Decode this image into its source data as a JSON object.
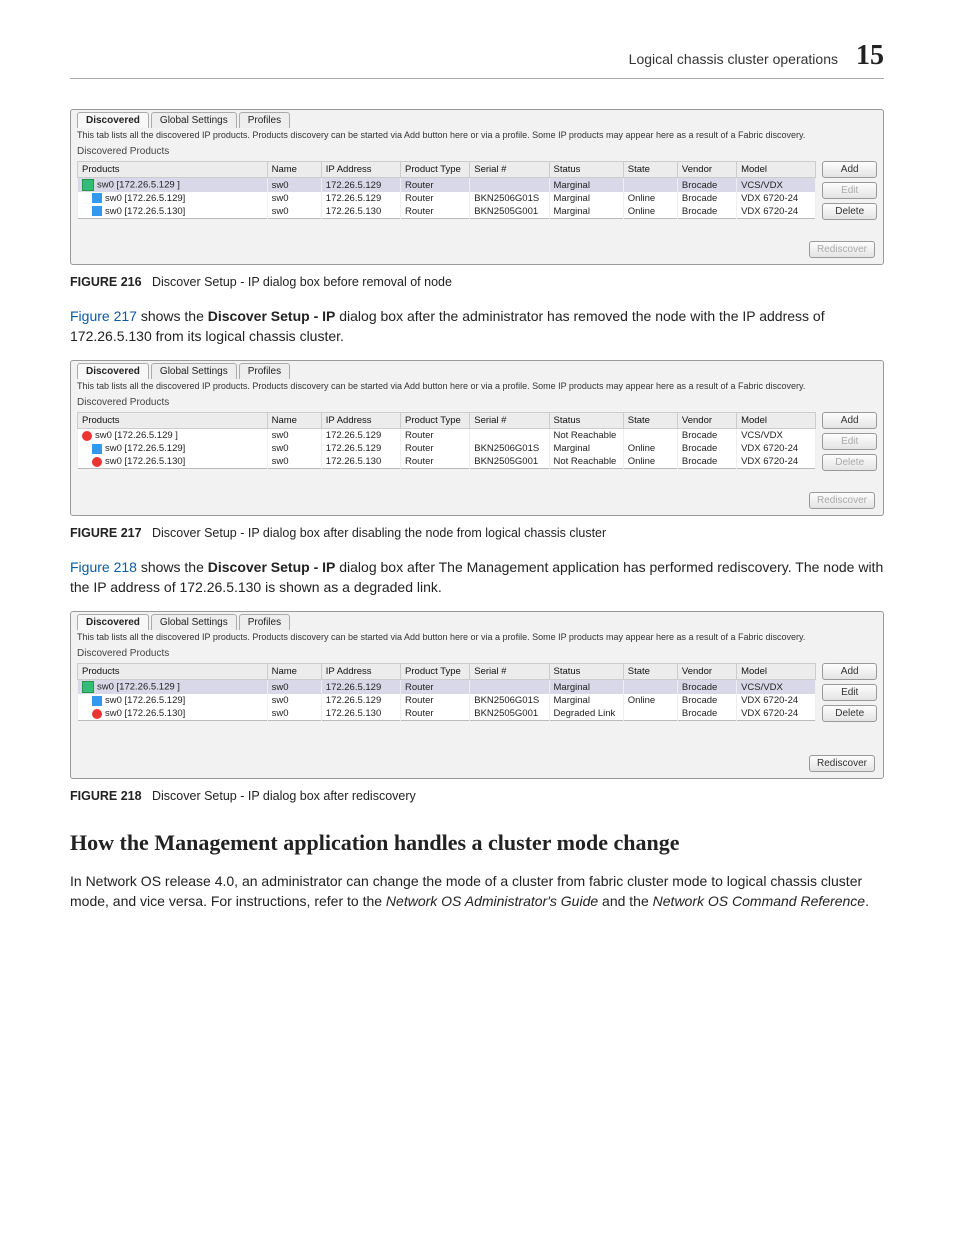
{
  "header": {
    "section": "Logical chassis cluster operations",
    "chapter": "15"
  },
  "tabs": {
    "t1": "Discovered",
    "t2": "Global Settings",
    "t3": "Profiles"
  },
  "hint": "This tab lists all the discovered IP products. Products discovery can be started via Add button here or via a profile. Some IP products may appear here as a result of a Fabric discovery.",
  "group": "Discovered Products",
  "columns": {
    "prod": "Products",
    "name": "Name",
    "ip": "IP Address",
    "ptype": "Product Type",
    "ser": "Serial #",
    "stat": "Status",
    "state": "State",
    "vend": "Vendor",
    "model": "Model"
  },
  "buttons": {
    "add": "Add",
    "edit": "Edit",
    "del": "Delete",
    "redisc": "Rediscover"
  },
  "fig216": {
    "caption_label": "FIGURE 216",
    "caption_text": "Discover Setup - IP dialog box before removal of node",
    "rows": [
      {
        "indent": 0,
        "iconkind": "tree",
        "prod": "sw0 [172.26.5.129 ]",
        "name": "sw0",
        "ip": "172.26.5.129",
        "ptype": "Router",
        "ser": "",
        "stat": "Marginal",
        "state": "",
        "vend": "Brocade",
        "model": "VCS/VDX",
        "sel": true
      },
      {
        "indent": 1,
        "iconkind": "node",
        "prod": "sw0 [172.26.5.129]",
        "name": "sw0",
        "ip": "172.26.5.129",
        "ptype": "Router",
        "ser": "BKN2506G01S",
        "stat": "Marginal",
        "state": "Online",
        "vend": "Brocade",
        "model": "VDX 6720-24"
      },
      {
        "indent": 1,
        "iconkind": "node",
        "prod": "sw0 [172.26.5.130]",
        "name": "sw0",
        "ip": "172.26.5.130",
        "ptype": "Router",
        "ser": "BKN2505G001",
        "stat": "Marginal",
        "state": "Online",
        "vend": "Brocade",
        "model": "VDX 6720-24"
      }
    ]
  },
  "para1": {
    "link": "Figure 217",
    "before": " shows the ",
    "bold": "Discover Setup - IP",
    "after": " dialog box after the administrator has removed the node with the IP address of 172.26.5.130 from its logical chassis cluster."
  },
  "fig217": {
    "caption_label": "FIGURE 217",
    "caption_text": "Discover Setup - IP dialog box after disabling the node from logical chassis cluster",
    "rows": [
      {
        "indent": 0,
        "iconkind": "sw",
        "prod": "sw0 [172.26.5.129 ]",
        "name": "sw0",
        "ip": "172.26.5.129",
        "ptype": "Router",
        "ser": "",
        "stat": "Not Reachable",
        "state": "",
        "vend": "Brocade",
        "model": "VCS/VDX"
      },
      {
        "indent": 1,
        "iconkind": "node",
        "prod": "sw0 [172.26.5.129]",
        "name": "sw0",
        "ip": "172.26.5.129",
        "ptype": "Router",
        "ser": "BKN2506G01S",
        "stat": "Marginal",
        "state": "Online",
        "vend": "Brocade",
        "model": "VDX 6720-24"
      },
      {
        "indent": 1,
        "iconkind": "sw",
        "prod": "sw0 [172.26.5.130]",
        "name": "sw0",
        "ip": "172.26.5.130",
        "ptype": "Router",
        "ser": "BKN2505G001",
        "stat": "Not Reachable",
        "state": "Online",
        "vend": "Brocade",
        "model": "VDX 6720-24"
      }
    ]
  },
  "para2": {
    "link": "Figure 218",
    "before": " shows the ",
    "bold": "Discover Setup - IP",
    "after": " dialog box after The Management application has performed rediscovery. The node with the IP address of 172.26.5.130 is shown as a degraded link."
  },
  "fig218": {
    "caption_label": "FIGURE 218",
    "caption_text": "Discover Setup - IP dialog box after rediscovery",
    "rows": [
      {
        "indent": 0,
        "iconkind": "tree",
        "prod": "sw0 [172.26.5.129 ]",
        "name": "sw0",
        "ip": "172.26.5.129",
        "ptype": "Router",
        "ser": "",
        "stat": "Marginal",
        "state": "",
        "vend": "Brocade",
        "model": "VCS/VDX",
        "sel": true
      },
      {
        "indent": 1,
        "iconkind": "node",
        "prod": "sw0 [172.26.5.129]",
        "name": "sw0",
        "ip": "172.26.5.129",
        "ptype": "Router",
        "ser": "BKN2506G01S",
        "stat": "Marginal",
        "state": "Online",
        "vend": "Brocade",
        "model": "VDX 6720-24"
      },
      {
        "indent": 1,
        "iconkind": "sw",
        "prod": "sw0 [172.26.5.130]",
        "name": "sw0",
        "ip": "172.26.5.130",
        "ptype": "Router",
        "ser": "BKN2505G001",
        "stat": "Degraded Link",
        "state": "",
        "vend": "Brocade",
        "model": "VDX 6720-24"
      }
    ]
  },
  "heading": "How the Management application handles a cluster mode change",
  "para3": {
    "t1": "In Network OS release 4.0, an administrator can change the mode of a cluster from fabric cluster mode to logical chassis cluster mode, and vice versa. For instructions, refer to the ",
    "i1": "Network OS Administrator's Guide",
    "t2": " and the ",
    "i2": "Network OS Command Reference",
    "t3": "."
  }
}
